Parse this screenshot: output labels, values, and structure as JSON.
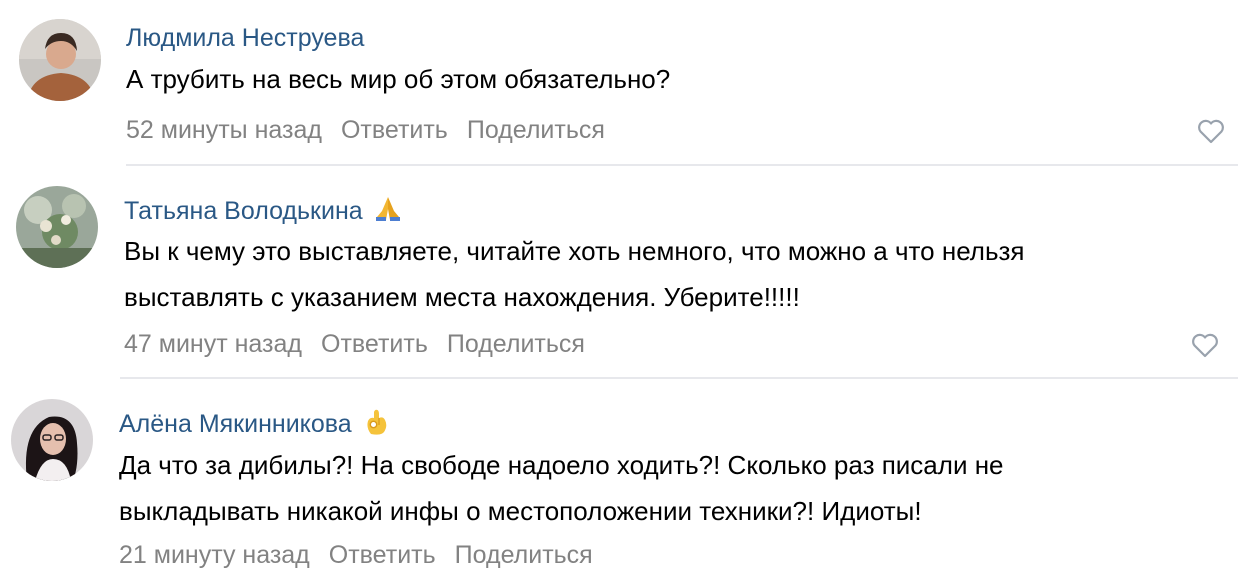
{
  "comments": [
    {
      "author": "Людмила Неструева",
      "lines": [
        "А трубить на весь мир об этом обязательно?"
      ],
      "time": "52 минуты назад",
      "reply_label": "Ответить",
      "share_label": "Поделиться",
      "emoji": ""
    },
    {
      "author": "Татьяна Володькина",
      "lines": [
        "Вы к чему это выставляете, читайте хоть немного, что можно а что нельзя",
        "выставлять с указанием места нахождения. Уберите!!!!!"
      ],
      "time": "47 минут назад",
      "reply_label": "Ответить",
      "share_label": "Поделиться",
      "emoji": "folded-hands"
    },
    {
      "author": "Алёна Мякинникова",
      "lines": [
        "Да что за дибилы?! На свободе надоело ходить?! Сколько раз писали не",
        "выкладывать никакой инфы о местоположении техники?! Идиоты!"
      ],
      "time": "21 минуту назад",
      "reply_label": "Ответить",
      "share_label": "Поделиться",
      "emoji": "ok-hand"
    }
  ],
  "colors": {
    "author_link": "#2a5885",
    "meta_text": "#828282",
    "body_text": "#000000",
    "divider": "#e7e8ec",
    "like_icon": "#99a2ad"
  },
  "icons": {
    "like": "heart-outline-icon"
  }
}
